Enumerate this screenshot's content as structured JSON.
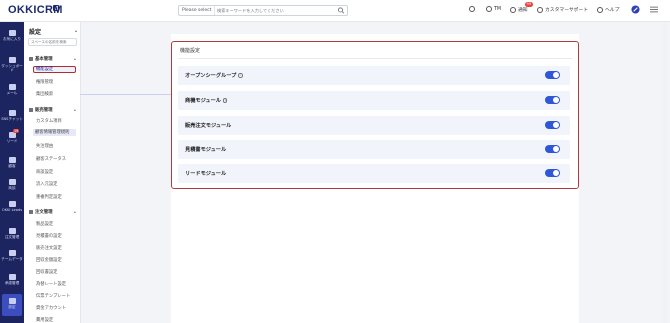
{
  "header": {
    "logo": "OKKICRM",
    "logo_badge": "AI",
    "search_select": "Please select",
    "search_placeholder": "検索キーワードを入力してください",
    "user": "TM",
    "notify": "通知",
    "notify_badge": "99",
    "support": "カスタマーサポート",
    "help": "ヘルプ"
  },
  "leftnav": {
    "items": [
      {
        "label": "お気に入り"
      },
      {
        "label": "ダッシュボード"
      },
      {
        "label": "メール"
      },
      {
        "label": "SNSチャット"
      },
      {
        "label": "リード",
        "badge": "19"
      },
      {
        "label": "顧客"
      },
      {
        "label": "商談"
      },
      {
        "label": "OKKI Leads"
      },
      {
        "label": "注文管理"
      },
      {
        "label": "チームデータ"
      },
      {
        "label": "承認管理"
      },
      {
        "label": "設定"
      }
    ]
  },
  "submenu": {
    "title": "設定",
    "search_placeholder": "スペースの名前を検索",
    "groups": [
      {
        "label": "基本管理",
        "items": [
          "機能設定",
          "権限管理",
          "集団検索"
        ]
      },
      {
        "label": "販売管理",
        "items": [
          "カスタム項目",
          "顧客情報管理規則",
          "失注理由",
          "顧客ステータス",
          "商談設定",
          "流入元設定",
          "重複判定設定"
        ]
      },
      {
        "label": "注文管理",
        "items": [
          "製品設定",
          "見積書の設定",
          "販売注文設定",
          "回収金額設定",
          "回収書設定",
          "為替レート設定",
          "伝票テンプレート",
          "資金アカウント",
          "費用設定"
        ]
      }
    ]
  },
  "content": {
    "title": "機能設定",
    "rows": [
      {
        "label": "オープンシーグループ",
        "info": true,
        "enabled": true
      },
      {
        "label": "商機モジュール",
        "info": true,
        "enabled": true
      },
      {
        "label": "販売注文モジュール",
        "info": false,
        "enabled": true
      },
      {
        "label": "見積書モジュール",
        "info": false,
        "enabled": true
      },
      {
        "label": "リードモジュール",
        "info": false,
        "enabled": true
      }
    ]
  },
  "colors": {
    "nav_bg": "#1c2560",
    "accent": "#2f57d8",
    "highlight_border": "#b33a3a"
  }
}
